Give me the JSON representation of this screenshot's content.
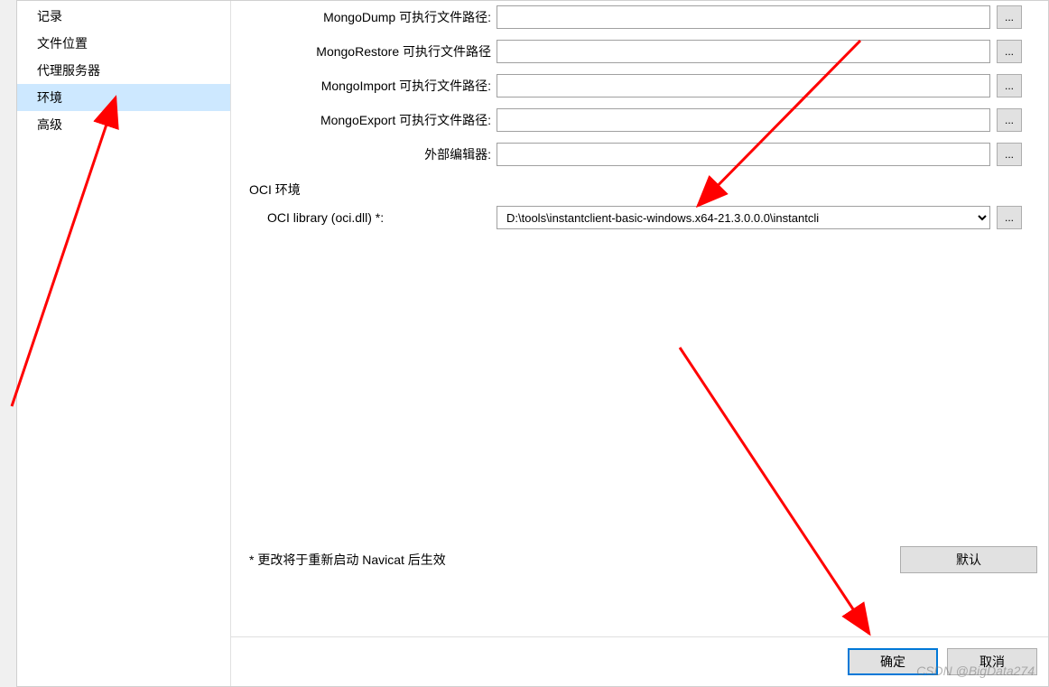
{
  "sidebar": {
    "items": [
      {
        "label": "记录",
        "selected": false
      },
      {
        "label": "文件位置",
        "selected": false
      },
      {
        "label": "代理服务器",
        "selected": false
      },
      {
        "label": "环境",
        "selected": true
      },
      {
        "label": "高级",
        "selected": false
      }
    ]
  },
  "form": {
    "mongodump_label": "MongoDump 可执行文件路径:",
    "mongodump_value": "",
    "mongorestore_label": "MongoRestore 可执行文件路径",
    "mongorestore_value": "",
    "mongoimport_label": "MongoImport 可执行文件路径:",
    "mongoimport_value": "",
    "mongoexport_label": "MongoExport 可执行文件路径:",
    "mongoexport_value": "",
    "external_editor_label": "外部编辑器:",
    "external_editor_value": "",
    "oci_section": "OCI 环境",
    "oci_library_label": "OCI library (oci.dll) *:",
    "oci_library_value": "D:\\tools\\instantclient-basic-windows.x64-21.3.0.0.0\\instantcli",
    "browse_label": "..."
  },
  "note": {
    "text": "* 更改将于重新启动 Navicat 后生效",
    "default_btn": "默认"
  },
  "footer": {
    "ok": "确定",
    "cancel": "取消"
  },
  "watermark": "CSDN @BigData274"
}
